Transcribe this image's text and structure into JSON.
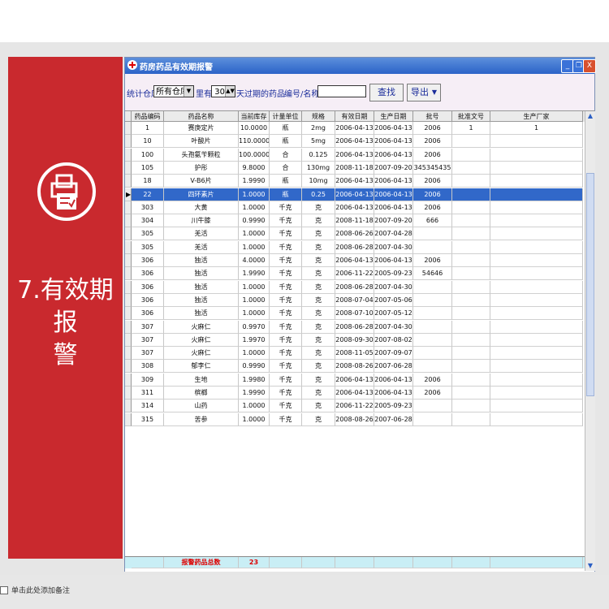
{
  "left_panel": {
    "title_line1": "7.有效期报",
    "title_line2": "警",
    "icon": "document-printer-icon"
  },
  "window": {
    "title": "药房药品有效期报警",
    "buttons": {
      "minimize": "_",
      "restore": "❐",
      "close": "X"
    }
  },
  "toolbar": {
    "warehouse_label": "统计仓库",
    "warehouse_value": "所有仓库",
    "within_label": "里有",
    "days_value": "30",
    "days_suffix": "天过期的药品",
    "code_label": "编号/名称:",
    "code_value": "",
    "search_button": "查找",
    "export_button": "导出"
  },
  "table": {
    "columns": [
      "药品编码",
      "药品名称",
      "当前库存",
      "计量单位",
      "规格",
      "有效日期",
      "生产日期",
      "批号",
      "批准文号",
      "生产厂家"
    ],
    "selected_index": 5,
    "rows": [
      [
        "1",
        "赛庚定片",
        "10.0000",
        "瓶",
        "2mg",
        "2006-04-13",
        "2006-04-13",
        "2006",
        "1",
        "1"
      ],
      [
        "10",
        "叶酸片",
        "110.0000",
        "瓶",
        "5mg",
        "2006-04-13",
        "2006-04-13",
        "2006",
        "",
        ""
      ],
      [
        "100",
        "头孢氨苄颗粒",
        "100.0000",
        "合",
        "0.125",
        "2006-04-13",
        "2006-04-13",
        "2006",
        "",
        ""
      ],
      [
        "105",
        "护彤",
        "9.8000",
        "合",
        "130mg",
        "2008-11-18",
        "2007-09-20",
        "345345435",
        "",
        ""
      ],
      [
        "18",
        "V-B6片",
        "1.9990",
        "瓶",
        "10mg",
        "2006-04-13",
        "2006-04-13",
        "2006",
        "",
        ""
      ],
      [
        "22",
        "四环素片",
        "1.0000",
        "瓶",
        "0.25",
        "2006-04-13",
        "2006-04-13",
        "2006",
        "",
        ""
      ],
      [
        "303",
        "大黄",
        "1.0000",
        "千克",
        "克",
        "2006-04-13",
        "2006-04-13",
        "2006",
        "",
        ""
      ],
      [
        "304",
        "川牛膝",
        "0.9990",
        "千克",
        "克",
        "2008-11-18",
        "2007-09-20",
        "666",
        "",
        ""
      ],
      [
        "305",
        "羌活",
        "1.0000",
        "千克",
        "克",
        "2008-06-26",
        "2007-04-28",
        "",
        "",
        ""
      ],
      [
        "305",
        "羌活",
        "1.0000",
        "千克",
        "克",
        "2008-06-28",
        "2007-04-30",
        "",
        "",
        ""
      ],
      [
        "306",
        "独活",
        "4.0000",
        "千克",
        "克",
        "2006-04-13",
        "2006-04-13",
        "2006",
        "",
        ""
      ],
      [
        "306",
        "独活",
        "1.9990",
        "千克",
        "克",
        "2006-11-22",
        "2005-09-23",
        "54646",
        "",
        ""
      ],
      [
        "306",
        "独活",
        "1.0000",
        "千克",
        "克",
        "2008-06-28",
        "2007-04-30",
        "",
        "",
        ""
      ],
      [
        "306",
        "独活",
        "1.0000",
        "千克",
        "克",
        "2008-07-04",
        "2007-05-06",
        "",
        "",
        ""
      ],
      [
        "306",
        "独活",
        "1.0000",
        "千克",
        "克",
        "2008-07-10",
        "2007-05-12",
        "",
        "",
        ""
      ],
      [
        "307",
        "火麻仁",
        "0.9970",
        "千克",
        "克",
        "2008-06-28",
        "2007-04-30",
        "",
        "",
        ""
      ],
      [
        "307",
        "火麻仁",
        "1.9970",
        "千克",
        "克",
        "2008-09-30",
        "2007-08-02",
        "",
        "",
        ""
      ],
      [
        "307",
        "火麻仁",
        "1.0000",
        "千克",
        "克",
        "2008-11-05",
        "2007-09-07",
        "",
        "",
        ""
      ],
      [
        "308",
        "郁李仁",
        "0.9990",
        "千克",
        "克",
        "2008-08-26",
        "2007-06-28",
        "",
        "",
        ""
      ],
      [
        "309",
        "生地",
        "1.9980",
        "千克",
        "克",
        "2006-04-13",
        "2006-04-13",
        "2006",
        "",
        ""
      ],
      [
        "311",
        "槟榔",
        "1.9990",
        "千克",
        "克",
        "2006-04-13",
        "2006-04-13",
        "2006",
        "",
        ""
      ],
      [
        "314",
        "山药",
        "1.0000",
        "千克",
        "克",
        "2006-11-22",
        "2005-09-23",
        "",
        "",
        ""
      ],
      [
        "315",
        "苦参",
        "1.0000",
        "千克",
        "克",
        "2008-08-26",
        "2007-06-28",
        "",
        "",
        ""
      ]
    ],
    "total_label": "报警药品总数",
    "total_value": "23"
  },
  "status_bar": {
    "hint": "单击此处添加备注"
  }
}
